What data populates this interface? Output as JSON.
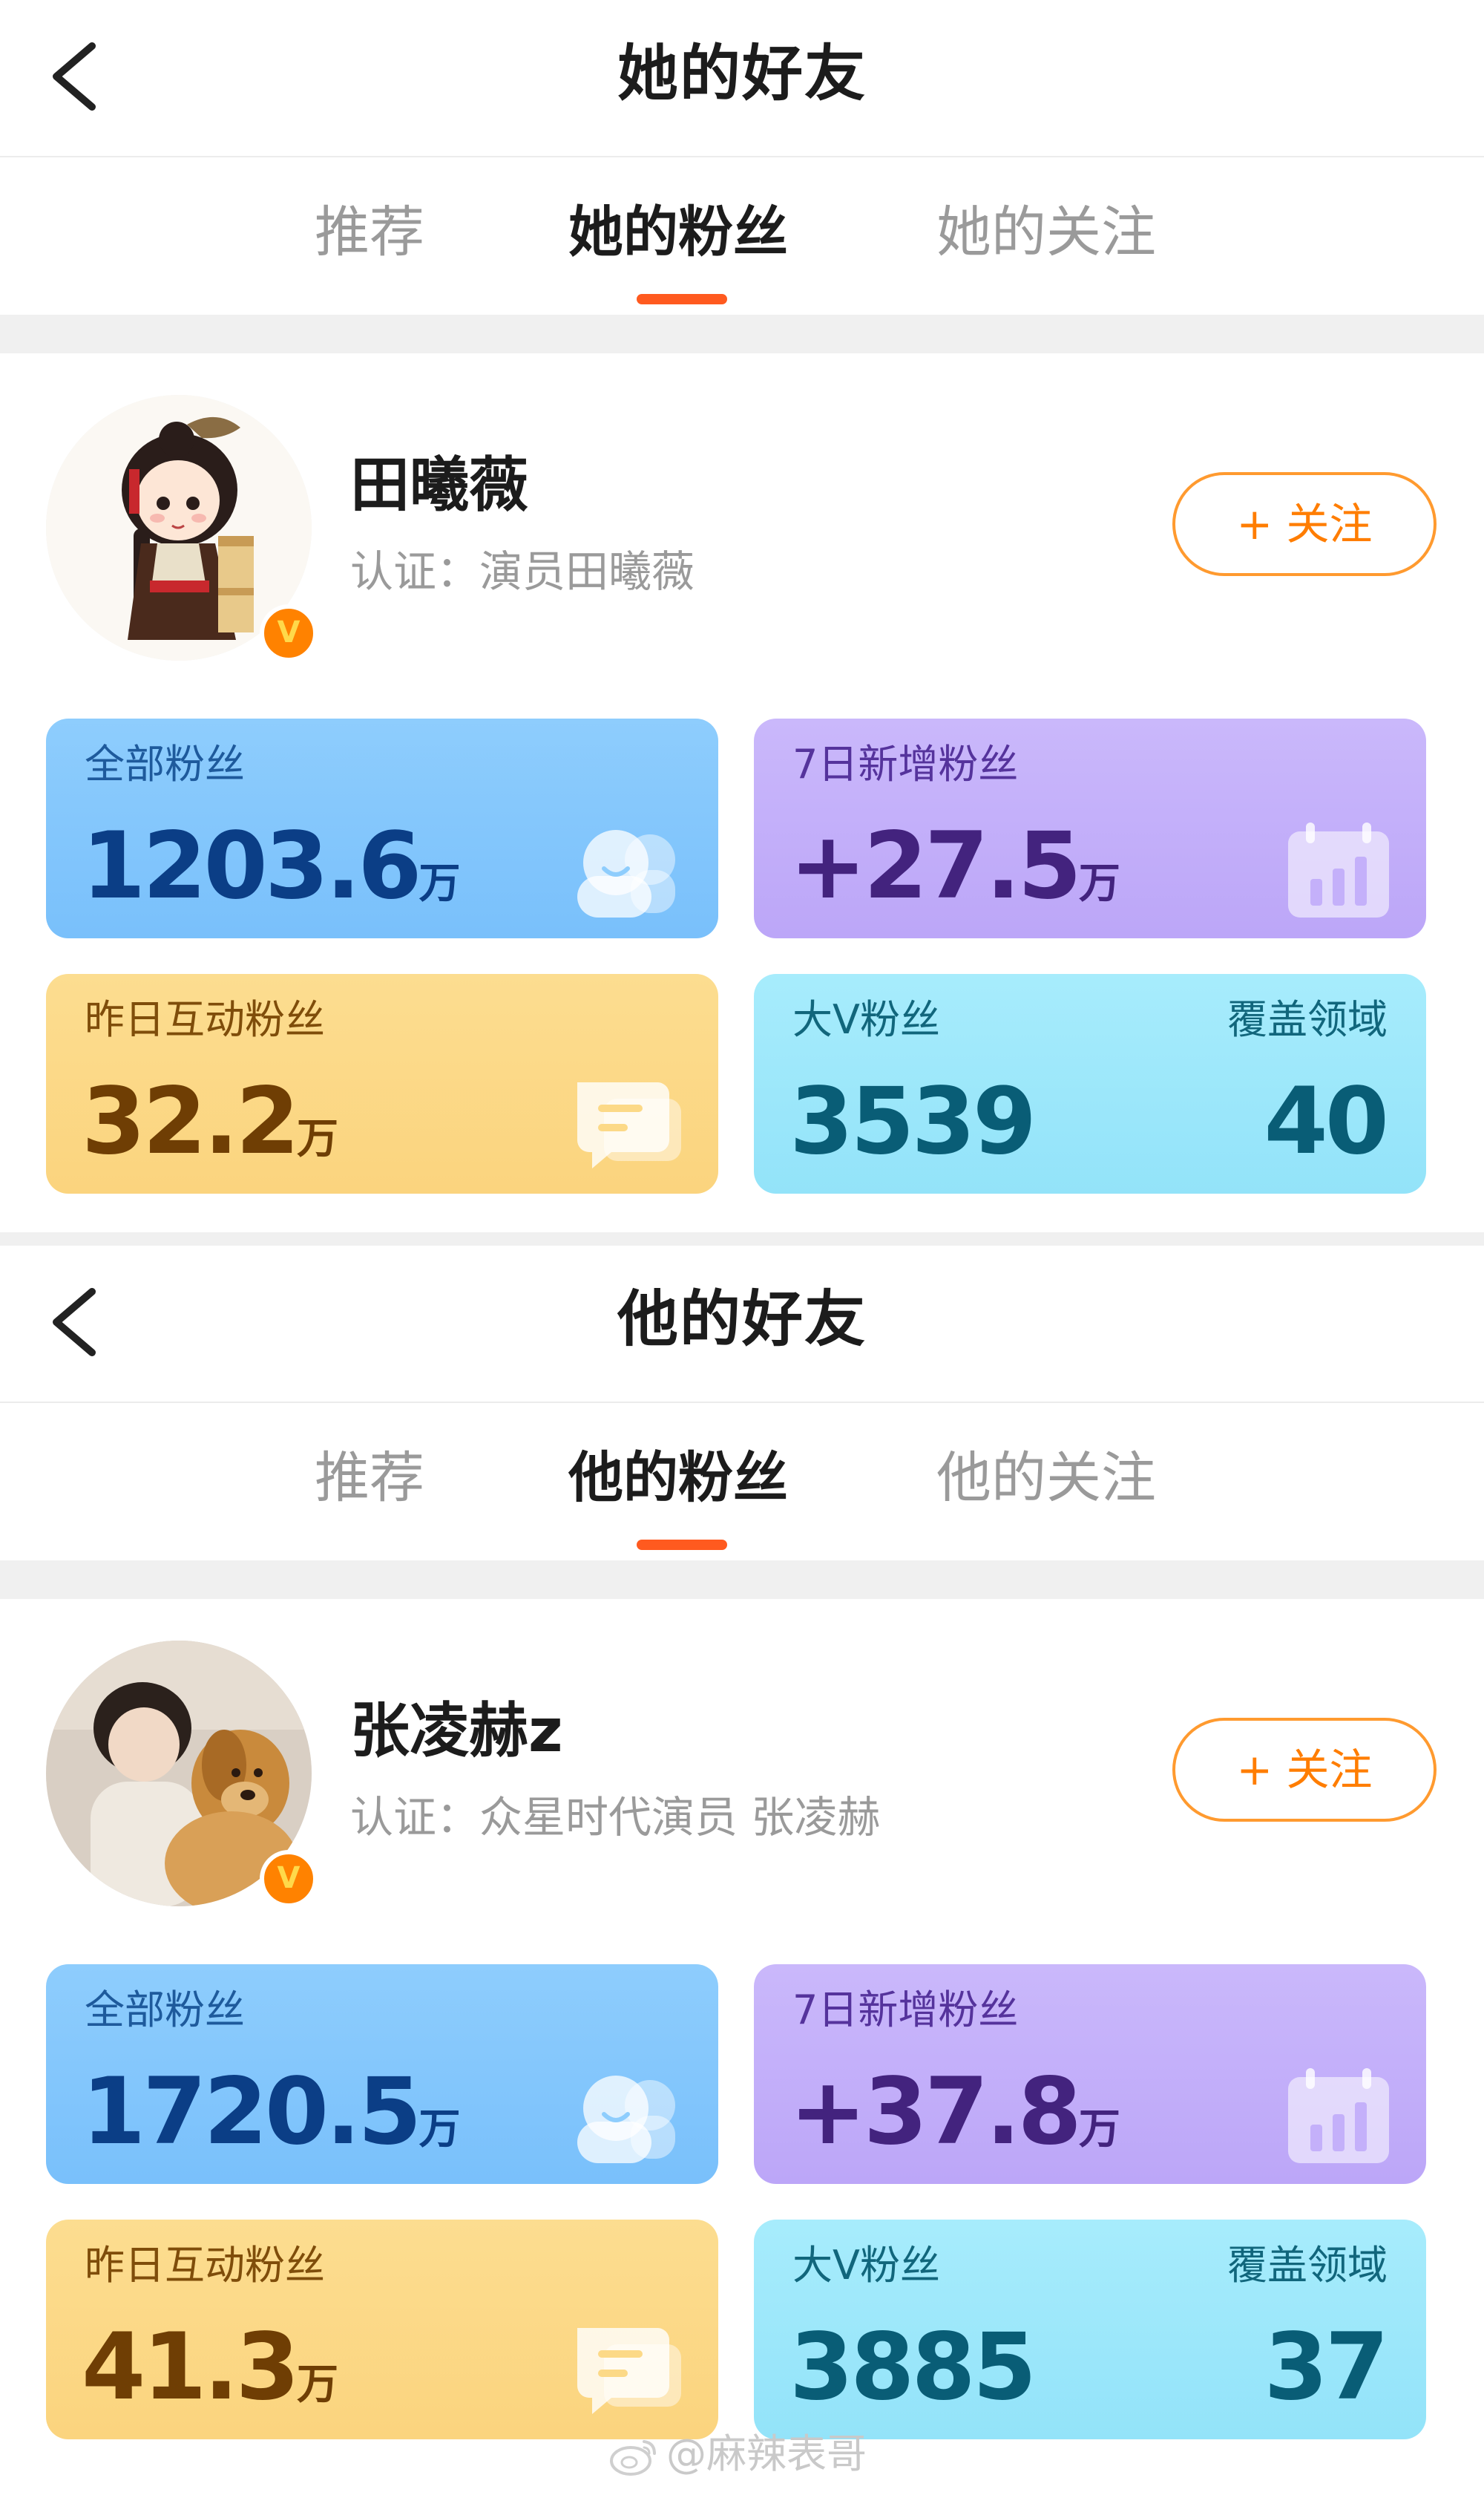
{
  "sections": [
    {
      "title": "她的好友",
      "tabs": [
        {
          "label": "推荐",
          "active": false
        },
        {
          "label": "她的粉丝",
          "active": true
        },
        {
          "label": "她的关注",
          "active": false
        }
      ],
      "profile": {
        "name": "田曦薇",
        "certification": "认证：演员田曦薇",
        "follow_label": "+ 关注",
        "verified_badge": "V"
      },
      "stats": {
        "all_fans": {
          "label": "全部粉丝",
          "value": "1203.6",
          "unit": "万"
        },
        "new_fans_7d": {
          "label": "7日新增粉丝",
          "value": "+27.5",
          "unit": "万"
        },
        "active_fans_yesterday": {
          "label": "昨日互动粉丝",
          "value": "32.2",
          "unit": "万"
        },
        "bigv_fans": {
          "label": "大V粉丝",
          "value": "3539",
          "domain_label": "覆盖领域",
          "domain_value": "40"
        }
      }
    },
    {
      "title": "他的好友",
      "tabs": [
        {
          "label": "推荐",
          "active": false
        },
        {
          "label": "他的粉丝",
          "active": true
        },
        {
          "label": "他的关注",
          "active": false
        }
      ],
      "profile": {
        "name": "张凌赫z",
        "certification": "认证：众星时代演员 张凌赫",
        "follow_label": "+ 关注",
        "verified_badge": "V"
      },
      "stats": {
        "all_fans": {
          "label": "全部粉丝",
          "value": "1720.5",
          "unit": "万"
        },
        "new_fans_7d": {
          "label": "7日新增粉丝",
          "value": "+37.8",
          "unit": "万"
        },
        "active_fans_yesterday": {
          "label": "昨日互动粉丝",
          "value": "41.3",
          "unit": "万"
        },
        "bigv_fans": {
          "label": "大V粉丝",
          "value": "3885",
          "domain_label": "覆盖领域",
          "domain_value": "37"
        }
      }
    }
  ],
  "watermark": "@麻辣表哥",
  "colors": {
    "accent": "#ff5a1f",
    "follow": "#ff7d00",
    "card_blue": "#86c8fc",
    "card_purple": "#c4b0fa",
    "card_yellow": "#fcd987",
    "card_cyan": "#9ee8fb"
  },
  "icons": {
    "back": "chevron-left-icon",
    "fans_card": "people-icon",
    "growth_card": "bar-chart-icon",
    "interaction_card": "chat-bubble-icon",
    "watermark": "weibo-logo-icon"
  }
}
